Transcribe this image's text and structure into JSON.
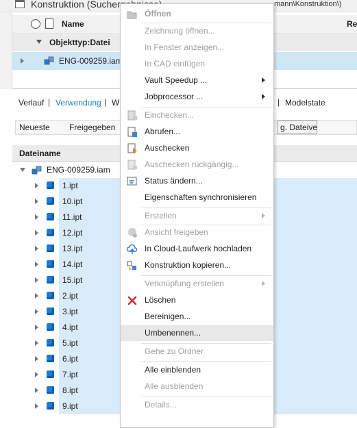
{
  "window": {
    "title": "Konstruktion   (Suchergebnisse)",
    "path": "mann\\Konstruktion\\)"
  },
  "grid1": {
    "name_header": "Name",
    "ret_header": "Re",
    "group_label": "Objekttyp:Datei",
    "row_name": "ENG-009259.iam"
  },
  "tabs": [
    {
      "label": "Verlauf"
    },
    {
      "label": "Verwendung"
    },
    {
      "label": "W"
    },
    {
      "label": "Modelstate"
    }
  ],
  "subtabs": {
    "neueste": "Neueste",
    "freigegeben": "Freigegeben",
    "button": "g. Dateivers."
  },
  "grid2": {
    "header": "Dateiname",
    "root": "ENG-009259.iam",
    "parts": [
      "1.ipt",
      "10.ipt",
      "11.ipt",
      "12.ipt",
      "13.ipt",
      "14.ipt",
      "15.ipt",
      "2.ipt",
      "3.ipt",
      "4.ipt",
      "5.ipt",
      "6.ipt",
      "7.ipt",
      "8.ipt",
      "9.ipt"
    ]
  },
  "menu": {
    "oeffnen": "Öffnen",
    "zeichnung": "Zeichnung öffnen...",
    "fenster": "In Fenster anzeigen...",
    "cad": "In CAD einfügen",
    "speedup": "Vault Speedup ...",
    "jobprocessor": "Jobprocessor  ...",
    "einchecken": "Einchecken...",
    "abrufen": "Abrufen...",
    "auschecken": "Auschecken",
    "rueckgaengig": "Auschecken rückgängig...",
    "status": "Status ändern...",
    "eigenschaften": "Eigenschaften synchronisieren",
    "erstellen": "Erstellen",
    "ansicht": "Ansicht freigeben",
    "cloud": "In Cloud-Laufwerk hochladen",
    "kopieren": "Konstruktion kopieren...",
    "verknuepfung": "Verknüpfung erstellen",
    "loeschen": "Löschen",
    "bereinigen": "Bereinigen...",
    "umbenennen": "Umbenennen...",
    "ordner": "Gehe zu Ordner",
    "einblenden": "Alle einblenden",
    "ausblenden": "Alle ausblenden",
    "details": "Details..."
  },
  "colors": {
    "selection": "#cfe6f5",
    "accent": "#1a7dc4",
    "delete_red": "#d23030",
    "part_blue": "#1e7ad6"
  }
}
